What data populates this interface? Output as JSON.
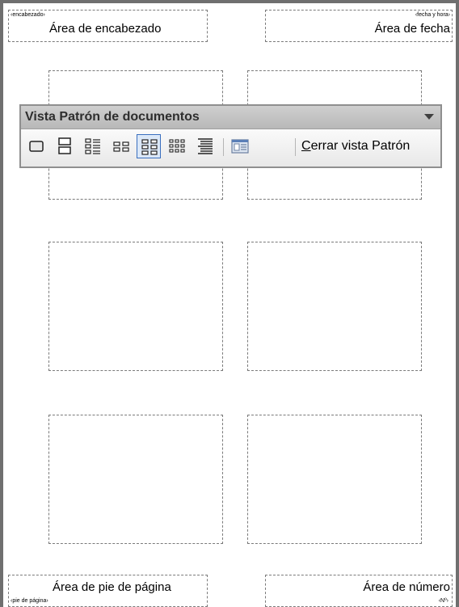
{
  "header": {
    "left_tag": "‹encabezado›",
    "left_text": "Área de encabezado",
    "right_tag": "‹fecha y hora›",
    "right_text": "Área de fecha"
  },
  "footer": {
    "left_tag": "‹pie de página›",
    "left_text": "Área de pie de página",
    "right_tag": "‹Nº›",
    "right_text": "Área de número"
  },
  "toolbar": {
    "title": "Vista Patrón de documentos",
    "close_first_letter": "C",
    "close_rest": "errar vista Patrón",
    "buttons": [
      {
        "icon": "one-slide-per-page-icon"
      },
      {
        "icon": "two-slides-per-page-icon"
      },
      {
        "icon": "three-slides-per-page-icon"
      },
      {
        "icon": "four-slides-per-page-icon"
      },
      {
        "icon": "six-slides-per-page-icon",
        "active": true
      },
      {
        "icon": "nine-slides-per-page-icon"
      },
      {
        "icon": "outline-view-icon"
      },
      {
        "icon": "handout-master-layout-icon"
      }
    ]
  },
  "colors": {
    "frame": "#6f6f6f",
    "toolbar_title_bg": "#c4c4c4",
    "active_button_border": "#3a6fbf",
    "active_button_bg": "#dbe8f8"
  }
}
